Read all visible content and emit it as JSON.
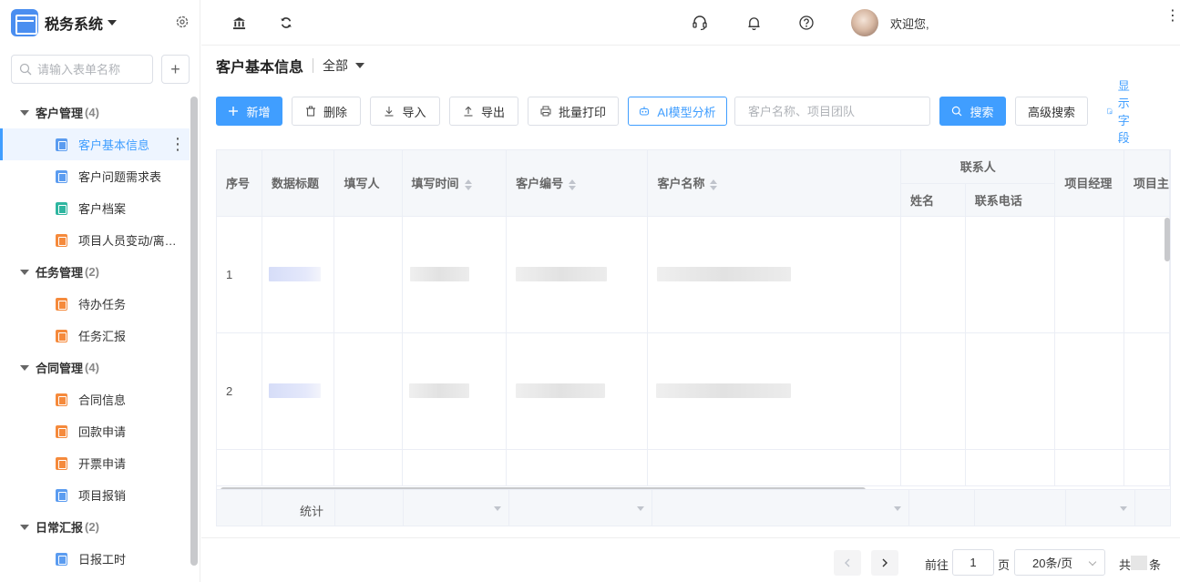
{
  "app": {
    "title": "税务系统"
  },
  "sidebar": {
    "search_placeholder": "请输入表单名称",
    "add_label": "+",
    "groups": [
      {
        "label": "客户管理",
        "count": "(4)",
        "items": [
          {
            "label": "客户基本信息",
            "icon": "form-icon-blue",
            "active": true
          },
          {
            "label": "客户问题需求表",
            "icon": "form-icon-blue"
          },
          {
            "label": "客户档案",
            "icon": "form-icon-teal"
          },
          {
            "label": "项目人员变动/离…",
            "icon": "form-icon-orange"
          }
        ]
      },
      {
        "label": "任务管理",
        "count": "(2)",
        "items": [
          {
            "label": "待办任务",
            "icon": "form-icon-orange"
          },
          {
            "label": "任务汇报",
            "icon": "form-icon-orange"
          }
        ]
      },
      {
        "label": "合同管理",
        "count": "(4)",
        "items": [
          {
            "label": "合同信息",
            "icon": "form-icon-orange"
          },
          {
            "label": "回款申请",
            "icon": "form-icon-orange"
          },
          {
            "label": "开票申请",
            "icon": "form-icon-orange"
          },
          {
            "label": "项目报销",
            "icon": "form-icon-blue"
          }
        ]
      },
      {
        "label": "日常汇报",
        "count": "(2)",
        "items": [
          {
            "label": "日报工时",
            "icon": "form-icon-blue"
          }
        ]
      }
    ]
  },
  "topbar": {
    "icons": [
      "bank-icon",
      "refresh-icon",
      "headset-icon",
      "bell-icon",
      "help-icon"
    ],
    "welcome": "欢迎您,",
    "more": "⋮"
  },
  "page": {
    "title": "客户基本信息",
    "scope": "全部"
  },
  "toolbar": {
    "add": "新增",
    "delete": "删除",
    "import": "导入",
    "export": "导出",
    "batch_print": "批量打印",
    "ai_analysis": "AI模型分析",
    "search_placeholder": "客户名称、项目团队",
    "search": "搜索",
    "advanced_search": "高级搜索",
    "show_fields": "显示字段"
  },
  "table": {
    "headers": {
      "index": "序号",
      "data_title": "数据标题",
      "filler": "填写人",
      "fill_time": "填写时间",
      "customer_no": "客户编号",
      "customer_name": "客户名称",
      "contact_group": "联系人",
      "contact_name": "姓名",
      "contact_phone": "联系电话",
      "project_manager": "项目经理",
      "project_partial": "项目主"
    },
    "rows": [
      {
        "index": "1"
      },
      {
        "index": "2"
      }
    ],
    "footer_label": "统计"
  },
  "pagination": {
    "goto": "前往",
    "page_value": "1",
    "page_unit": "页",
    "page_size": "20条/页",
    "total_prefix": "共",
    "total_suffix": "条"
  },
  "colors": {
    "primary": "#409eff",
    "active_bg": "#eef5ff"
  }
}
